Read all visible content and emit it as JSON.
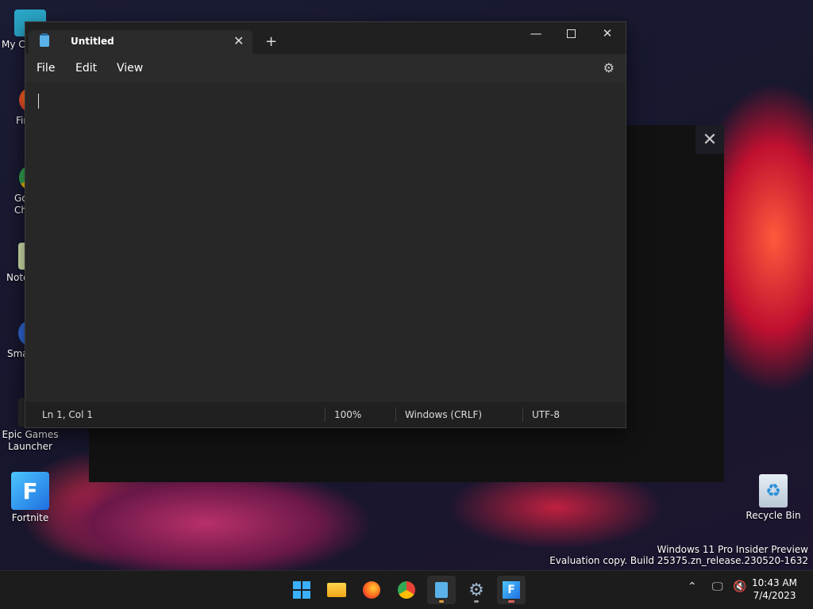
{
  "desktop": {
    "icons": [
      {
        "label": "My Computer"
      },
      {
        "label": "Firefox"
      },
      {
        "label": "Google Chrome"
      },
      {
        "label": "Notepad++"
      },
      {
        "label": "Smart"
      },
      {
        "label": "Epic Games Launcher"
      },
      {
        "label": "Fortnite"
      },
      {
        "label": "Recycle Bin"
      }
    ]
  },
  "notepad": {
    "tab_title": "Untitled",
    "menu": {
      "file": "File",
      "edit": "Edit",
      "view": "View"
    },
    "status": {
      "position": "Ln 1, Col 1",
      "zoom": "100%",
      "line_ending": "Windows (CRLF)",
      "encoding": "UTF-8"
    }
  },
  "watermark": {
    "line1": "Windows 11 Pro Insider Preview",
    "line2": "Evaluation copy. Build 25375.zn_release.230520-1632"
  },
  "taskbar": {
    "time": "10:43 AM",
    "date": "7/4/2023"
  },
  "icons": {
    "start": "windows-start-icon",
    "explorer": "folder-icon",
    "firefox": "firefox-icon",
    "chrome": "chrome-icon",
    "notepad": "notepad-icon",
    "settings": "gear-icon",
    "fortnite": "fortnite-icon"
  }
}
